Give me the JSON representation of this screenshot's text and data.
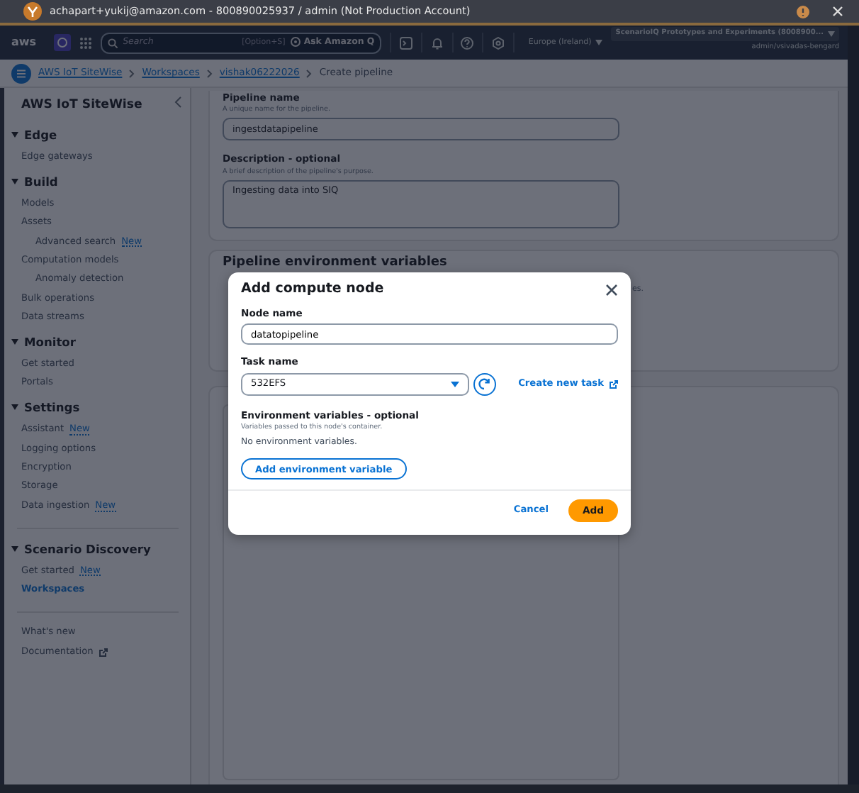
{
  "title_bar": {
    "title": "achapart+yukij@amazon.com - 800890025937 / admin (Not Production Account)"
  },
  "top_nav": {
    "logo": "aws",
    "search": {
      "placeholder": "Search"
    },
    "search_shortcut": "[Option+S]",
    "ask_button": "Ask Amazon Q",
    "region": "Europe (Ireland)",
    "account": "ScenarioIQ Prototypes and Experiments (8008900...",
    "user": "admin/vsivadas-bengard"
  },
  "breadcrumbs": [
    {
      "label": "AWS IoT SiteWise",
      "link": true
    },
    {
      "label": "Workspaces",
      "link": true
    },
    {
      "label": "vishak06222026",
      "link": true
    },
    {
      "label": "Create pipeline",
      "link": false
    }
  ],
  "sidebar": {
    "title": "AWS IoT SiteWise",
    "sections": [
      {
        "label": "Edge",
        "expanded": true,
        "items": [
          {
            "label": "Edge gateways",
            "selected": false
          }
        ]
      },
      {
        "label": "Build",
        "expanded": true,
        "items": [
          {
            "label": "Models",
            "selected": false
          },
          {
            "label": "Assets",
            "selected": false,
            "children": [
              {
                "label": "Advanced search",
                "badge": "New",
                "selected": false
              }
            ]
          },
          {
            "label": "Computation models",
            "selected": false,
            "children": [
              {
                "label": "Anomaly detection",
                "selected": false
              }
            ]
          },
          {
            "label": "Bulk operations",
            "selected": false
          },
          {
            "label": "Data streams",
            "selected": false
          }
        ]
      },
      {
        "label": "Monitor",
        "expanded": true,
        "items": [
          {
            "label": "Get started",
            "selected": false
          },
          {
            "label": "Portals",
            "selected": false
          }
        ]
      },
      {
        "label": "Settings",
        "expanded": true,
        "items": [
          {
            "label": "Assistant",
            "badge": "New",
            "selected": false
          },
          {
            "label": "Logging options",
            "selected": false
          },
          {
            "label": "Encryption",
            "selected": false
          },
          {
            "label": "Storage",
            "selected": false
          },
          {
            "label": "Data ingestion",
            "badge": "New",
            "selected": false
          }
        ]
      },
      {
        "label": "Scenario Discovery",
        "expanded": true,
        "items": [
          {
            "label": "Get started",
            "badge": "New",
            "selected": false
          },
          {
            "label": "Workspaces",
            "selected": true
          }
        ]
      }
    ],
    "footer_links": [
      {
        "label": "What's new",
        "external": false
      },
      {
        "label": "Documentation",
        "external": true
      }
    ]
  },
  "pipeline_form": {
    "name_label": "Pipeline name",
    "name_hint": "A unique name for the pipeline.",
    "name_value": "ingestdatapipeline",
    "description_label": "Description - optional",
    "description_hint": "A brief description of the pipeline's purpose.",
    "description_value": "Ingesting data into SIQ"
  },
  "env_card": {
    "heading": "Pipeline environment variables",
    "text_fragment": "es."
  },
  "modal": {
    "title": "Add compute node",
    "node_name_label": "Node name",
    "node_name_value": "datatopipeline",
    "task_name_label": "Task name",
    "task_name_value": "532EFS",
    "create_task_link": "Create new task",
    "env_heading": "Environment variables - optional",
    "env_hint": "Variables passed to this node's container.",
    "env_empty": "No environment variables.",
    "add_env_button": "Add environment variable",
    "cancel_button": "Cancel",
    "add_button": "Add"
  }
}
